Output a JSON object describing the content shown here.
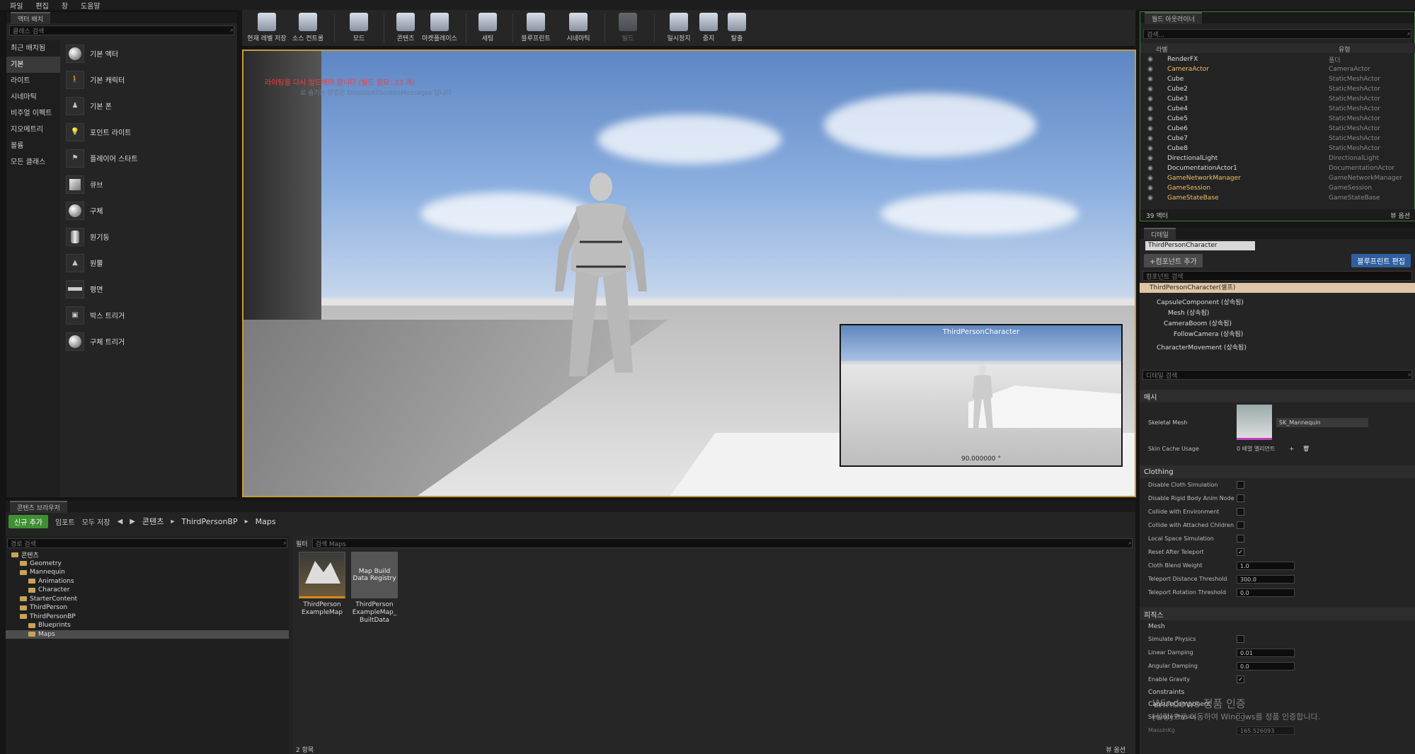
{
  "menu": [
    "파일",
    "편집",
    "창",
    "도움말"
  ],
  "place_actors": {
    "tab": "액터 배치",
    "search_placeholder": "클래스 검색",
    "categories": [
      "최근 배치됨",
      "기본",
      "라이트",
      "시네마틱",
      "비주얼 이펙트",
      "지오메트리",
      "볼륨",
      "모든 클래스"
    ],
    "selected_category": "기본",
    "items": [
      "기본 액터",
      "기본 캐릭터",
      "기본 폰",
      "포인트 라이트",
      "플레이어 스타트",
      "큐브",
      "구체",
      "원기둥",
      "원뿔",
      "평면",
      "박스 트리거",
      "구체 트리거"
    ]
  },
  "toolbar": {
    "buttons": [
      "현재 레벨 저장",
      "소스 컨트롤",
      "모드",
      "콘텐츠",
      "마켓플레이스",
      "세팅",
      "블루프린트",
      "시네마틱",
      "빌드",
      "일시정지",
      "중지",
      "탈출"
    ]
  },
  "viewport": {
    "warning": "라이팅을 다시 빌드해야 합니다 (빌드 필요: 33 개)",
    "hint": "로 숨기는 방법은 DisableAllScreenMessages 입니다",
    "pip_title": "ThirdPersonCharacter",
    "pip_value": "90.000000 °"
  },
  "outliner": {
    "tab": "월드 아웃라이너",
    "search_placeholder": "검색...",
    "col_label": "라벨",
    "col_type": "유형",
    "rows": [
      {
        "label": "RenderFX",
        "type": "폴더",
        "hi": false
      },
      {
        "label": "CameraActor",
        "type": "CameraActor",
        "hi": true
      },
      {
        "label": "Cube",
        "type": "StaticMeshActor",
        "hi": false
      },
      {
        "label": "Cube2",
        "type": "StaticMeshActor",
        "hi": false
      },
      {
        "label": "Cube3",
        "type": "StaticMeshActor",
        "hi": false
      },
      {
        "label": "Cube4",
        "type": "StaticMeshActor",
        "hi": false
      },
      {
        "label": "Cube5",
        "type": "StaticMeshActor",
        "hi": false
      },
      {
        "label": "Cube6",
        "type": "StaticMeshActor",
        "hi": false
      },
      {
        "label": "Cube7",
        "type": "StaticMeshActor",
        "hi": false
      },
      {
        "label": "Cube8",
        "type": "StaticMeshActor",
        "hi": false
      },
      {
        "label": "DirectionalLight",
        "type": "DirectionalLight",
        "hi": false
      },
      {
        "label": "DocumentationActor1",
        "type": "DocumentationActor",
        "hi": false
      },
      {
        "label": "GameNetworkManager",
        "type": "GameNetworkManager",
        "hi": true
      },
      {
        "label": "GameSession",
        "type": "GameSession",
        "hi": true
      },
      {
        "label": "GameStateBase",
        "type": "GameStateBase",
        "hi": true
      }
    ],
    "count": "39 액터",
    "view_options": "뷰 옵션"
  },
  "details": {
    "tab": "디테일",
    "name": "ThirdPersonCharacter",
    "add_component": "+컴포넌트 추가",
    "edit_blueprint": "블루프린트 편집",
    "component_search": "컴포넌트 검색",
    "self": "ThirdPersonCharacter(셀프)",
    "components": [
      "CapsuleComponent (상속됨)",
      "Mesh (상속됨)",
      "CameraBoom (상속됨)",
      "FollowCamera (상속됨)",
      "CharacterMovement (상속됨)"
    ],
    "detail_search": "디테일 검색",
    "mesh_section": "메시",
    "skeletal_mesh_label": "Skeletal Mesh",
    "skeletal_mesh_value": "SK_Mannequin",
    "skin_cache_label": "Skin Cache Usage",
    "skin_cache_value": "0 배열 엘리먼트",
    "clothing_section": "Clothing",
    "clothing": [
      {
        "label": "Disable Cloth Simulation",
        "kind": "check",
        "value": ""
      },
      {
        "label": "Disable Rigid Body Anim Node",
        "kind": "check",
        "value": ""
      },
      {
        "label": "Collide with Environment",
        "kind": "check",
        "value": ""
      },
      {
        "label": "Collide with Attached Children",
        "kind": "check",
        "value": ""
      },
      {
        "label": "Local Space Simulation",
        "kind": "check",
        "value": ""
      },
      {
        "label": "Reset After Teleport",
        "kind": "check",
        "value": "✓"
      },
      {
        "label": "Cloth Blend Weight",
        "kind": "num",
        "value": "1.0"
      },
      {
        "label": "Teleport Distance Threshold",
        "kind": "num",
        "value": "300.0"
      },
      {
        "label": "Teleport Rotation Threshold",
        "kind": "num",
        "value": "0.0"
      }
    ],
    "physics_section": "피직스",
    "physics_sub": "Mesh",
    "physics": [
      {
        "label": "Simulate Physics",
        "kind": "check",
        "value": ""
      },
      {
        "label": "Linear Damping",
        "kind": "num",
        "value": "0.01"
      },
      {
        "label": "Angular Damping",
        "kind": "num",
        "value": "0.0"
      },
      {
        "label": "Enable Gravity",
        "kind": "check",
        "value": "✓"
      }
    ],
    "constraints": "Constraints",
    "capsule_sub": "CapsuleComponent",
    "capsule_sim": "Simulate Physics",
    "mass_label": "MassInKg",
    "mass_value": "165.526093"
  },
  "content_browser": {
    "tab": "콘텐츠 브라우저",
    "add_new": "신규 추가",
    "import": "임포트",
    "save_all": "모두 저장",
    "crumbs": [
      "콘텐츠",
      "ThirdPersonBP",
      "Maps"
    ],
    "path_search": "경로 검색",
    "filter": "필터",
    "asset_search": "검색 Maps",
    "tree": [
      {
        "label": "콘텐츠",
        "indent": 0,
        "sel": false
      },
      {
        "label": "Geometry",
        "indent": 1,
        "sel": false
      },
      {
        "label": "Mannequin",
        "indent": 1,
        "sel": false
      },
      {
        "label": "Animations",
        "indent": 2,
        "sel": false
      },
      {
        "label": "Character",
        "indent": 2,
        "sel": false
      },
      {
        "label": "StarterContent",
        "indent": 1,
        "sel": false
      },
      {
        "label": "ThirdPerson",
        "indent": 1,
        "sel": false
      },
      {
        "label": "ThirdPersonBP",
        "indent": 1,
        "sel": false
      },
      {
        "label": "Blueprints",
        "indent": 2,
        "sel": false
      },
      {
        "label": "Maps",
        "indent": 2,
        "sel": true
      }
    ],
    "assets": [
      {
        "label": "ThirdPerson ExampleMap",
        "tile": ""
      },
      {
        "label": "ThirdPerson ExampleMap_ BuiltData",
        "tile": "Map Build Data Registry"
      }
    ],
    "item_count": "2 항목",
    "view_options": "뷰 옵션"
  },
  "watermark": {
    "line1": "Windows 정품 인증",
    "line2": "[설정]으로 이동하여 Windows를 정품 인증합니다."
  }
}
